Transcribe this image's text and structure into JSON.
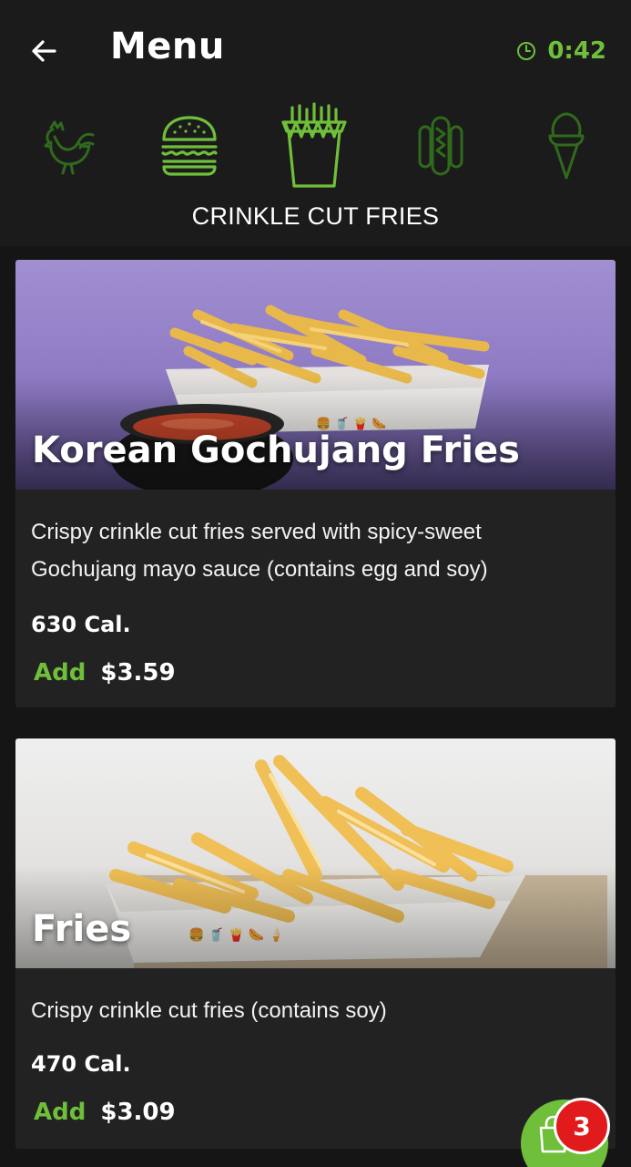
{
  "header": {
    "title": "Menu",
    "timer": "0:42"
  },
  "categories": [
    {
      "name": "chicken-icon",
      "active": false
    },
    {
      "name": "burger-icon",
      "active": false
    },
    {
      "name": "fries-icon",
      "active": true
    },
    {
      "name": "hot-dog-icon",
      "active": false
    },
    {
      "name": "ice-cream-icon",
      "active": false
    }
  ],
  "selected_category": "CRINKLE CUT FRIES",
  "items": [
    {
      "name": "Korean Gochujang Fries",
      "description": "Crispy crinkle cut fries served with spicy-sweet Gochujang mayo sauce (contains egg and soy)",
      "calories": "630 Cal.",
      "add_label": "Add",
      "price": "$3.59"
    },
    {
      "name": "Fries",
      "description": "Crispy crinkle cut fries (contains soy)",
      "calories": "470 Cal.",
      "add_label": "Add",
      "price": "$3.09"
    }
  ],
  "cart": {
    "count": "3"
  },
  "colors": {
    "accent": "#6fbf3a",
    "badge": "#e11b1b",
    "background": "#151515",
    "card": "#222222"
  }
}
